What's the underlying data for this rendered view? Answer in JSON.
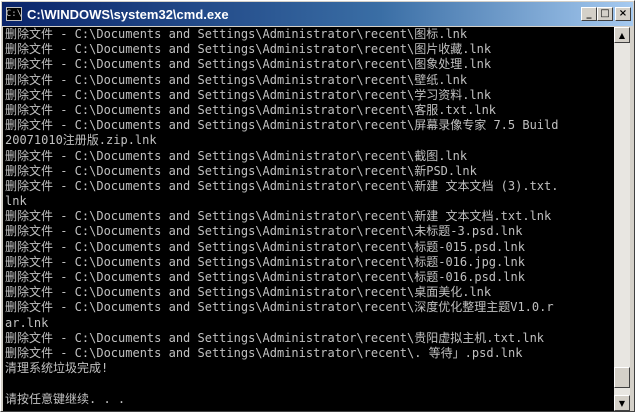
{
  "window": {
    "title": "C:\\WINDOWS\\system32\\cmd.exe",
    "buttons": {
      "minimize": "_",
      "maximize": "□",
      "close": "×"
    }
  },
  "console": {
    "lines": [
      "删除文件 - C:\\Documents and Settings\\Administrator\\recent\\图标.lnk",
      "删除文件 - C:\\Documents and Settings\\Administrator\\recent\\图片收藏.lnk",
      "删除文件 - C:\\Documents and Settings\\Administrator\\recent\\图象处理.lnk",
      "删除文件 - C:\\Documents and Settings\\Administrator\\recent\\壁纸.lnk",
      "删除文件 - C:\\Documents and Settings\\Administrator\\recent\\学习资料.lnk",
      "删除文件 - C:\\Documents and Settings\\Administrator\\recent\\客服.txt.lnk",
      "删除文件 - C:\\Documents and Settings\\Administrator\\recent\\屏幕录像专家 7.5 Build",
      "20071010注册版.zip.lnk",
      "删除文件 - C:\\Documents and Settings\\Administrator\\recent\\截图.lnk",
      "删除文件 - C:\\Documents and Settings\\Administrator\\recent\\新PSD.lnk",
      "删除文件 - C:\\Documents and Settings\\Administrator\\recent\\新建 文本文档 (3).txt.",
      "lnk",
      "删除文件 - C:\\Documents and Settings\\Administrator\\recent\\新建 文本文档.txt.lnk",
      "删除文件 - C:\\Documents and Settings\\Administrator\\recent\\未标题-3.psd.lnk",
      "删除文件 - C:\\Documents and Settings\\Administrator\\recent\\标题-015.psd.lnk",
      "删除文件 - C:\\Documents and Settings\\Administrator\\recent\\标题-016.jpg.lnk",
      "删除文件 - C:\\Documents and Settings\\Administrator\\recent\\标题-016.psd.lnk",
      "删除文件 - C:\\Documents and Settings\\Administrator\\recent\\桌面美化.lnk",
      "删除文件 - C:\\Documents and Settings\\Administrator\\recent\\深度优化整理主题V1.0.r",
      "ar.lnk",
      "删除文件 - C:\\Documents and Settings\\Administrator\\recent\\贵阳虚拟主机.txt.lnk",
      "删除文件 - C:\\Documents and Settings\\Administrator\\recent\\. 等待」.psd.lnk",
      "清理系统垃圾完成!",
      "",
      "请按任意键继续. . ."
    ]
  },
  "scrollbar": {
    "position": 0.98,
    "visible_fraction": 0.06
  }
}
